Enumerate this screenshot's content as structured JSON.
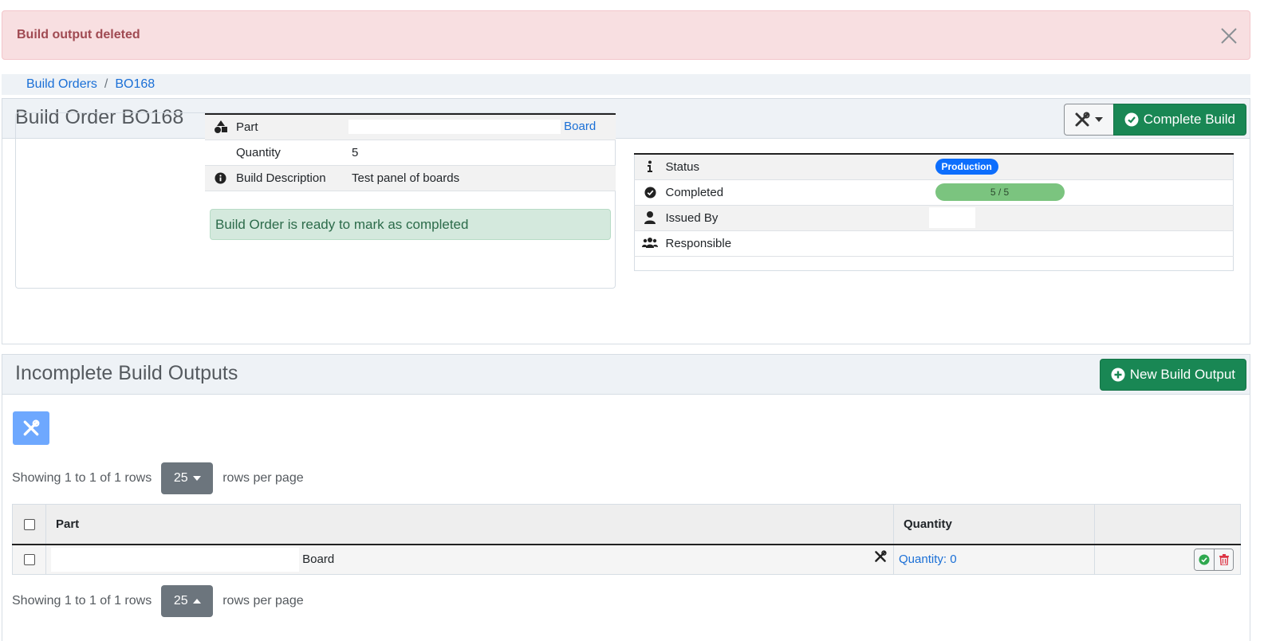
{
  "alert": {
    "message": "Build output deleted"
  },
  "breadcrumb": {
    "items": [
      "Build Orders",
      "BO168"
    ],
    "separator": "/"
  },
  "build": {
    "title": "Build Order BO168",
    "complete_label": "Complete Build",
    "details": {
      "part_label": "Part",
      "part_value": "Board",
      "quantity_label": "Quantity",
      "quantity_value": "5",
      "description_label": "Build Description",
      "description_value": "Test panel of boards"
    },
    "ready_message": "Build Order is ready to mark as completed",
    "status": {
      "status_label": "Status",
      "status_badge": "Production",
      "completed_label": "Completed",
      "completed_value": "5 / 5",
      "completed_fraction": 1.0,
      "issued_label": "Issued By",
      "responsible_label": "Responsible"
    }
  },
  "outputs": {
    "title": "Incomplete Build Outputs",
    "new_label": "New Build Output",
    "pager_text": "Showing 1 to 1 of 1 rows",
    "page_size": "25",
    "rows_per_page": "rows per page",
    "columns": {
      "part": "Part",
      "quantity": "Quantity"
    },
    "rows": [
      {
        "part": "Board",
        "quantity": "Quantity: 0"
      }
    ]
  },
  "colors": {
    "primary": "#0d6efd",
    "success": "#198754",
    "danger_bg": "#f8dfe1",
    "header_bg": "#eef2f6"
  }
}
